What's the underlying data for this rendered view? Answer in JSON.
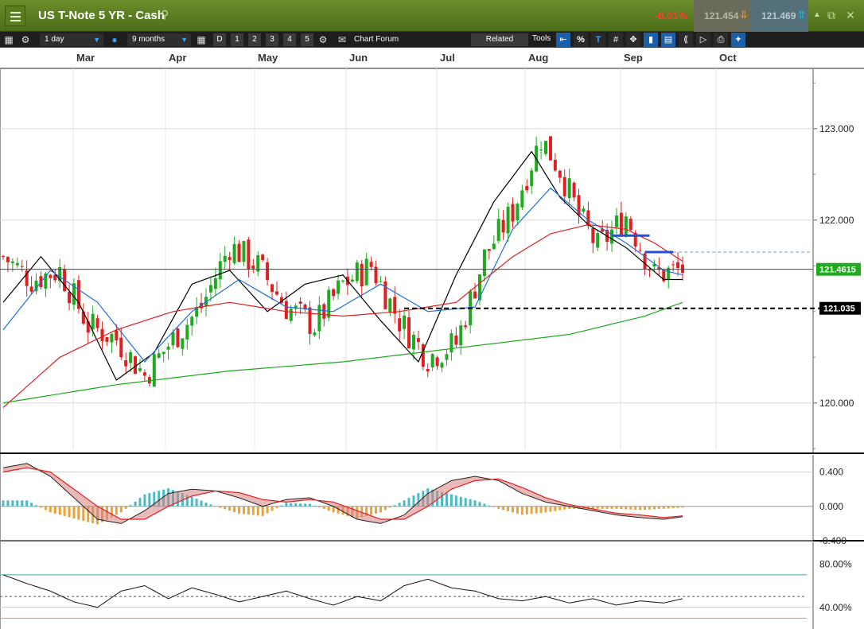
{
  "titlebar": {
    "title": "US T-Note 5 YR - Cash",
    "change": "-0.01%",
    "sell": "121.454",
    "buy": "121.469"
  },
  "toolbar": {
    "interval": "1 day",
    "range": "9 months",
    "zoom_buttons": [
      "D",
      "1",
      "2",
      "3",
      "4",
      "5"
    ],
    "chart_forum": "Chart Forum",
    "related": "Related",
    "tools": "Tools",
    "percent": "%"
  },
  "colors": {
    "up_candle": "#1faa1f",
    "down_candle": "#e02020",
    "ma_black": "#000000",
    "ma_blue": "#1e6fd9",
    "ma_red": "#e02020",
    "ma_green": "#1aa81a",
    "level_line": "#1e50d8",
    "macd_hist_pos": "#4fb8c8",
    "macd_hist_neg": "#f0a030"
  },
  "chart_data": [
    {
      "type": "candlestick",
      "months": [
        "Mar",
        "Apr",
        "May",
        "Jun",
        "Jul",
        "Aug",
        "Sep",
        "Oct"
      ],
      "ylim": [
        119.45,
        123.65
      ],
      "y_ticks": [
        "123.000",
        "122.000",
        "120.000"
      ],
      "current_price_label": "121.4615",
      "current_price": 121.4615,
      "support_label": "121.035",
      "support_level": 121.035,
      "resistance_levels": [
        121.83,
        121.65
      ],
      "bar_count": 145,
      "series": [
        {
          "name": "",
          "role": "close",
          "x": [
            0,
            6,
            12,
            18,
            24,
            30,
            36,
            42,
            48,
            54,
            60,
            66,
            72,
            78,
            84,
            90,
            96,
            102,
            108,
            114,
            118,
            122,
            126,
            132,
            138,
            144
          ],
          "values": [
            121.6,
            121.35,
            121.45,
            120.85,
            120.7,
            120.3,
            120.7,
            121.05,
            121.72,
            121.5,
            121.05,
            120.85,
            121.3,
            121.5,
            120.9,
            120.5,
            120.65,
            121.6,
            122.1,
            122.9,
            122.55,
            122.05,
            121.7,
            122.05,
            121.4,
            121.46
          ]
        },
        {
          "name": "",
          "role": "ma-short",
          "x": [
            0,
            8,
            16,
            24,
            32,
            40,
            48,
            56,
            64,
            72,
            80,
            88,
            96,
            104,
            112,
            118,
            124,
            132,
            140,
            144
          ],
          "values": [
            121.1,
            121.6,
            121.1,
            120.25,
            120.55,
            121.3,
            121.45,
            121.0,
            121.3,
            121.4,
            120.9,
            120.45,
            121.4,
            122.2,
            122.75,
            122.25,
            121.95,
            121.7,
            121.35,
            121.35
          ]
        },
        {
          "name": "",
          "role": "ma-mid",
          "x": [
            0,
            10,
            20,
            30,
            40,
            50,
            60,
            70,
            80,
            90,
            100,
            108,
            116,
            124,
            132,
            140,
            144
          ],
          "values": [
            120.8,
            121.45,
            121.1,
            120.45,
            121.0,
            121.35,
            121.05,
            121.0,
            121.3,
            121.0,
            121.05,
            121.9,
            122.35,
            122.0,
            121.75,
            121.45,
            121.4
          ]
        },
        {
          "name": "",
          "role": "ma-long",
          "x": [
            0,
            12,
            24,
            36,
            48,
            60,
            72,
            84,
            96,
            108,
            116,
            124,
            132,
            138,
            144
          ],
          "values": [
            119.95,
            120.5,
            120.8,
            121.0,
            121.1,
            121.0,
            120.95,
            121.0,
            121.1,
            121.6,
            121.85,
            121.95,
            121.9,
            121.75,
            121.55
          ]
        },
        {
          "name": "",
          "role": "ma-200",
          "x": [
            0,
            24,
            48,
            72,
            96,
            120,
            136,
            144
          ],
          "values": [
            120.0,
            120.2,
            120.35,
            120.45,
            120.6,
            120.75,
            120.95,
            121.1
          ]
        }
      ]
    },
    {
      "type": "line",
      "indicator": "MACD",
      "ylim": [
        -0.4,
        0.6
      ],
      "y_ticks": [
        "0.400",
        "0.000",
        "-0.400"
      ],
      "x": [
        0,
        5,
        10,
        15,
        20,
        25,
        30,
        35,
        40,
        45,
        50,
        55,
        60,
        65,
        70,
        75,
        80,
        85,
        90,
        95,
        100,
        105,
        110,
        115,
        120,
        125,
        130,
        135,
        140,
        144
      ],
      "series": [
        {
          "name": "",
          "role": "macd",
          "values": [
            0.45,
            0.5,
            0.35,
            0.1,
            -0.15,
            -0.2,
            -0.05,
            0.15,
            0.2,
            0.18,
            0.1,
            0.0,
            0.08,
            0.1,
            0.0,
            -0.15,
            -0.2,
            -0.1,
            0.15,
            0.3,
            0.35,
            0.3,
            0.15,
            0.05,
            0.0,
            -0.05,
            -0.1,
            -0.13,
            -0.15,
            -0.12
          ]
        },
        {
          "name": "",
          "role": "signal",
          "values": [
            0.4,
            0.45,
            0.4,
            0.2,
            0.0,
            -0.15,
            -0.15,
            0.0,
            0.12,
            0.18,
            0.16,
            0.08,
            0.05,
            0.08,
            0.05,
            -0.05,
            -0.15,
            -0.15,
            0.0,
            0.2,
            0.3,
            0.32,
            0.22,
            0.1,
            0.02,
            -0.03,
            -0.08,
            -0.1,
            -0.13,
            -0.11
          ]
        }
      ]
    },
    {
      "type": "line",
      "indicator": "RSI",
      "y_ticks": [
        "80.00%",
        "40.00%"
      ],
      "ylim": [
        20,
        100
      ],
      "x": [
        0,
        5,
        10,
        15,
        20,
        25,
        30,
        35,
        40,
        45,
        50,
        55,
        60,
        65,
        70,
        75,
        80,
        85,
        90,
        95,
        100,
        105,
        110,
        115,
        120,
        125,
        130,
        135,
        140,
        144
      ],
      "series": [
        {
          "name": "",
          "role": "rsi",
          "values": [
            70,
            62,
            55,
            45,
            40,
            55,
            60,
            48,
            58,
            52,
            45,
            50,
            55,
            48,
            42,
            50,
            46,
            60,
            66,
            58,
            55,
            48,
            46,
            50,
            44,
            48,
            42,
            46,
            44,
            48
          ]
        }
      ]
    }
  ]
}
